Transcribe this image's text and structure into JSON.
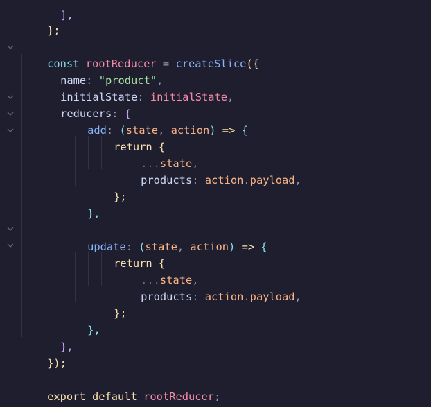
{
  "editor": {
    "language": "javascript",
    "theme_colors": {
      "background": "#1e1e2e",
      "keyword": "#cba6f7",
      "declaration": "#89dceb",
      "variable": "#f38ba8",
      "function": "#89b4fa",
      "string": "#a6e3a1",
      "bracket_level1": "#f9e2af",
      "bracket_level2": "#cba6f7",
      "bracket_level3": "#89dceb"
    },
    "fold_icon": "chevron-down-icon"
  },
  "code": {
    "l1": "],",
    "l2": "};",
    "slice_const": "const",
    "slice_name": "rootReducer",
    "slice_eq": "=",
    "slice_fn": "createSlice",
    "slice_open": "({",
    "name_key": "name",
    "name_colon": ":",
    "name_value": "\"product\"",
    "name_comma": ",",
    "init_key": "initialState",
    "init_value": "initialState",
    "reducers_key": "reducers",
    "reducers_open": "{",
    "add_name": "add",
    "update_name": "update",
    "paren_open": "(",
    "param_state": "state",
    "param_sep": ", ",
    "param_action": "action",
    "paren_close": ")",
    "arrow": "=>",
    "block_open": "{",
    "return_kw": "return",
    "return_open": "{",
    "spread": "...",
    "spread_target": "state",
    "products_key": "products",
    "payload_obj": "action",
    "payload_dot": ".",
    "payload_prop": "payload",
    "inner_close": "};",
    "fn_close": "},",
    "reducers_close": "},",
    "slice_close": "});",
    "export_kw": "export",
    "default_kw": "default",
    "export_target": "rootReducer",
    "semicolon": ";"
  }
}
